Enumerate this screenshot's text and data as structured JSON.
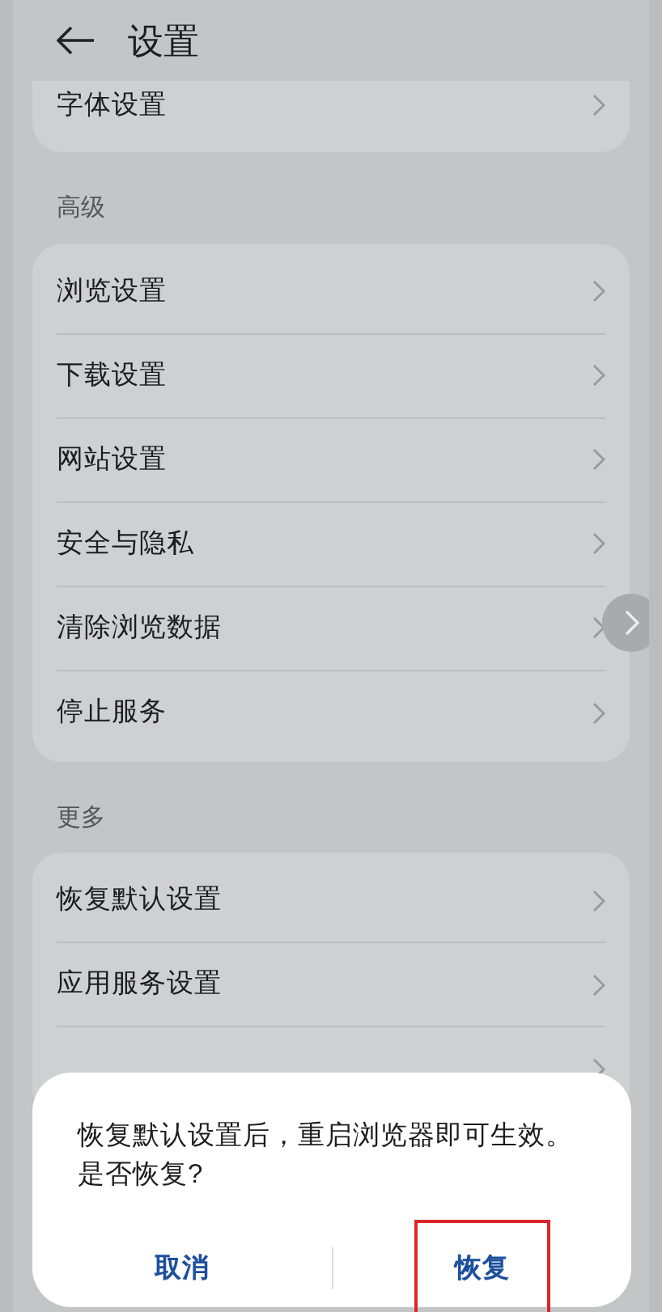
{
  "header": {
    "title": "设置"
  },
  "sections": [
    {
      "items": [
        {
          "label": "字体设置"
        }
      ]
    },
    {
      "title": "高级",
      "items": [
        {
          "label": "浏览设置"
        },
        {
          "label": "下载设置"
        },
        {
          "label": "网站设置"
        },
        {
          "label": "安全与隐私"
        },
        {
          "label": "清除浏览数据"
        },
        {
          "label": "停止服务"
        }
      ]
    },
    {
      "title": "更多",
      "items": [
        {
          "label": "恢复默认设置"
        },
        {
          "label": "应用服务设置"
        }
      ],
      "covered_row": true
    }
  ],
  "dialog": {
    "message": "恢复默认设置后，重启浏览器即可生效。是否恢复?",
    "buttons": [
      {
        "label": "取消",
        "highlighted": false
      },
      {
        "label": "恢复",
        "highlighted": true
      }
    ]
  }
}
